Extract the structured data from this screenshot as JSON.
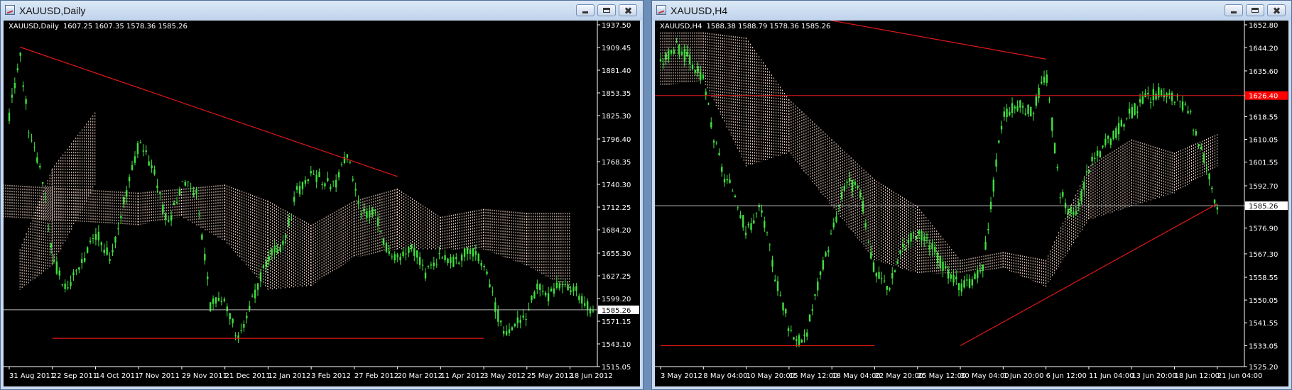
{
  "colors": {
    "background": "#000000",
    "candle_up": "#3fe03f",
    "cloud": "#f6d7c8",
    "trend": "#e01818",
    "price_line": "#b8b8b8",
    "axis": "#ffffff",
    "hline_label_bg": "#ff0000"
  },
  "icons": [
    "chart-window-icon",
    "minimize-icon",
    "maximize-icon",
    "close-icon"
  ],
  "windows": [
    {
      "title": "XAUUSD,Daily",
      "info": {
        "symbol": "XAUUSD,Daily",
        "ohlc": "1607.25 1607.35 1578.36 1585.26"
      }
    },
    {
      "title": "XAUUSD,H4",
      "info": {
        "symbol": "XAUUSD,H4",
        "ohlc": "1588.38 1588.79 1578.36 1585.26"
      }
    }
  ],
  "chart_data": [
    {
      "type": "candlestick",
      "symbol": "XAUUSD",
      "timeframe": "Daily",
      "y_ticks": [
        "1937.50",
        "1909.45",
        "1881.40",
        "1853.35",
        "1825.30",
        "1796.40",
        "1768.35",
        "1740.30",
        "1712.25",
        "1684.20",
        "1655.30",
        "1627.25",
        "1599.20",
        "1571.15",
        "1543.10",
        "1515.05"
      ],
      "ylim": [
        1515.05,
        1937.5
      ],
      "x_ticks": [
        "31 Aug 2011",
        "22 Sep 2011",
        "14 Oct 2011",
        "7 Nov 2011",
        "29 Nov 2011",
        "21 Dec 2011",
        "12 Jan 2012",
        "3 Feb 2012",
        "27 Feb 2012",
        "20 Mar 2012",
        "11 Apr 2012",
        "3 May 2012",
        "25 May 2012",
        "18 Jun 2012"
      ],
      "current_price": "1585.26",
      "close_path": [
        [
          "31 Aug 2011",
          1825
        ],
        [
          "5 Sep 2011",
          1900
        ],
        [
          "12 Sep 2011",
          1790
        ],
        [
          "20 Sep 2011",
          1760
        ],
        [
          "22 Sep 2011",
          1650
        ],
        [
          "26 Sep 2011",
          1610
        ],
        [
          "4 Oct 2011",
          1640
        ],
        [
          "14 Oct 2011",
          1680
        ],
        [
          "24 Oct 2011",
          1650
        ],
        [
          "1 Nov 2011",
          1720
        ],
        [
          "7 Nov 2011",
          1790
        ],
        [
          "14 Nov 2011",
          1760
        ],
        [
          "22 Nov 2011",
          1690
        ],
        [
          "29 Nov 2011",
          1740
        ],
        [
          "7 Dec 2011",
          1730
        ],
        [
          "14 Dec 2011",
          1590
        ],
        [
          "21 Dec 2011",
          1600
        ],
        [
          "29 Dec 2011",
          1545
        ],
        [
          "5 Jan 2012",
          1600
        ],
        [
          "12 Jan 2012",
          1650
        ],
        [
          "20 Jan 2012",
          1665
        ],
        [
          "27 Jan 2012",
          1730
        ],
        [
          "3 Feb 2012",
          1755
        ],
        [
          "10 Feb 2012",
          1745
        ],
        [
          "17 Feb 2012",
          1740
        ],
        [
          "24 Feb 2012",
          1785
        ],
        [
          "29 Feb 2012",
          1700
        ],
        [
          "5 Mar 2012",
          1710
        ],
        [
          "13 Mar 2012",
          1665
        ],
        [
          "20 Mar 2012",
          1650
        ],
        [
          "28 Mar 2012",
          1665
        ],
        [
          "4 Apr 2012",
          1630
        ],
        [
          "11 Apr 2012",
          1655
        ],
        [
          "18 Apr 2012",
          1645
        ],
        [
          "25 Apr 2012",
          1660
        ],
        [
          "3 May 2012",
          1640
        ],
        [
          "10 May 2012",
          1590
        ],
        [
          "16 May 2012",
          1550
        ],
        [
          "22 May 2012",
          1570
        ],
        [
          "25 May 2012",
          1575
        ],
        [
          "1 Jun 2012",
          1620
        ],
        [
          "8 Jun 2012",
          1600
        ],
        [
          "13 Jun 2012",
          1620
        ],
        [
          "18 Jun 2012",
          1615
        ],
        [
          "21 Jun 2012",
          1585
        ]
      ],
      "cloud": [
        [
          "5 Sep 2011",
          1610,
          1660
        ],
        [
          "22 Sep 2011",
          1640,
          1760
        ],
        [
          "14 Oct 2011",
          1740,
          1830
        ],
        [
          "28 Oct 2011",
          1700,
          1740
        ],
        [
          "7 Nov 2011",
          1690,
          1730
        ],
        [
          "29 Nov 2011",
          1700,
          1735
        ],
        [
          "21 Dec 2011",
          1670,
          1740
        ],
        [
          "12 Jan 2012",
          1610,
          1720
        ],
        [
          "3 Feb 2012",
          1615,
          1690
        ],
        [
          "27 Feb 2012",
          1650,
          1720
        ],
        [
          "20 Mar 2012",
          1660,
          1735
        ],
        [
          "11 Apr 2012",
          1660,
          1700
        ],
        [
          "3 May 2012",
          1660,
          1710
        ],
        [
          "25 May 2012",
          1640,
          1705
        ],
        [
          "18 Jun 2012",
          1610,
          1705
        ]
      ],
      "trendlines": [
        {
          "from": [
            "5 Sep 2011",
            1910
          ],
          "to": [
            "20 Mar 2012",
            1750
          ]
        },
        {
          "from": [
            "22 Sep 2011",
            1550
          ],
          "to": [
            "3 May 2012",
            1550
          ]
        }
      ],
      "candle_count": 210
    },
    {
      "type": "candlestick",
      "symbol": "XAUUSD",
      "timeframe": "H4",
      "y_ticks": [
        "1652.80",
        "1644.20",
        "1635.60",
        "1626.40",
        "1618.55",
        "1610.05",
        "1601.55",
        "1592.70",
        "1585.26",
        "1576.90",
        "1567.30",
        "1558.55",
        "1550.05",
        "1541.55",
        "1533.05",
        "1525.20"
      ],
      "ylim": [
        1525.2,
        1652.8
      ],
      "x_ticks": [
        "3 May 2012",
        "8 May 04:00",
        "10 May 20:00",
        "15 May 12:00",
        "18 May 04:00",
        "22 May 20:00",
        "25 May 12:00",
        "30 May 04:00",
        "1 Jun 20:00",
        "6 Jun 12:00",
        "11 Jun 04:00",
        "13 Jun 20:00",
        "18 Jun 12:00",
        "21 Jun 04:00"
      ],
      "current_price": "1585.26",
      "hline_label": "1626.40",
      "close_path": [
        [
          "3 May 2012",
          1638
        ],
        [
          "4 May 2012",
          1645
        ],
        [
          "7 May 2012",
          1640
        ],
        [
          "8 May 04:00",
          1632
        ],
        [
          "8 May 12:00",
          1610
        ],
        [
          "9 May 2012",
          1595
        ],
        [
          "10 May 04:00",
          1590
        ],
        [
          "10 May 20:00",
          1575
        ],
        [
          "11 May 2012",
          1585
        ],
        [
          "14 May 2012",
          1560
        ],
        [
          "15 May 12:00",
          1540
        ],
        [
          "16 May 2012",
          1533
        ],
        [
          "17 May 2012",
          1555
        ],
        [
          "18 May 04:00",
          1575
        ],
        [
          "18 May 20:00",
          1595
        ],
        [
          "21 May 2012",
          1590
        ],
        [
          "22 May 20:00",
          1560
        ],
        [
          "23 May 2012",
          1555
        ],
        [
          "24 May 2012",
          1570
        ],
        [
          "25 May 12:00",
          1575
        ],
        [
          "28 May 2012",
          1570
        ],
        [
          "29 May 2012",
          1560
        ],
        [
          "30 May 04:00",
          1555
        ],
        [
          "31 May 2012",
          1560
        ],
        [
          "1 Jun 20:00",
          1620
        ],
        [
          "4 Jun 2012",
          1623
        ],
        [
          "5 Jun 2012",
          1620
        ],
        [
          "6 Jun 12:00",
          1635
        ],
        [
          "7 Jun 2012",
          1590
        ],
        [
          "8 Jun 2012",
          1580
        ],
        [
          "11 Jun 04:00",
          1600
        ],
        [
          "12 Jun 2012",
          1610
        ],
        [
          "13 Jun 20:00",
          1620
        ],
        [
          "14 Jun 2012",
          1625
        ],
        [
          "15 Jun 2012",
          1628
        ],
        [
          "18 Jun 12:00",
          1625
        ],
        [
          "19 Jun 2012",
          1620
        ],
        [
          "20 Jun 2012",
          1605
        ],
        [
          "21 Jun 04:00",
          1585
        ]
      ],
      "cloud": [
        [
          "3 May 2012",
          1630,
          1650
        ],
        [
          "8 May 04:00",
          1632,
          1650
        ],
        [
          "10 May 20:00",
          1600,
          1648
        ],
        [
          "15 May 12:00",
          1605,
          1625
        ],
        [
          "18 May 04:00",
          1585,
          1610
        ],
        [
          "22 May 20:00",
          1565,
          1595
        ],
        [
          "25 May 12:00",
          1560,
          1585
        ],
        [
          "30 May 04:00",
          1560,
          1565
        ],
        [
          "1 Jun 20:00",
          1562,
          1568
        ],
        [
          "6 Jun 12:00",
          1555,
          1565
        ],
        [
          "11 Jun 04:00",
          1580,
          1600
        ],
        [
          "13 Jun 20:00",
          1585,
          1610
        ],
        [
          "18 Jun 12:00",
          1590,
          1605
        ],
        [
          "21 Jun 04:00",
          1600,
          1612
        ]
      ],
      "trendlines": [
        {
          "from": [
            "8 May 04:00",
            1663
          ],
          "to": [
            "6 Jun 12:00",
            1640
          ]
        },
        {
          "from": [
            "30 May 04:00",
            1533
          ],
          "to": [
            "21 Jun 04:00",
            1586
          ]
        },
        {
          "from": [
            "3 May 2012",
            1533
          ],
          "to": [
            "22 May 20:00",
            1533
          ]
        }
      ],
      "horizontal_line": 1626.4,
      "candle_count": 210
    }
  ]
}
